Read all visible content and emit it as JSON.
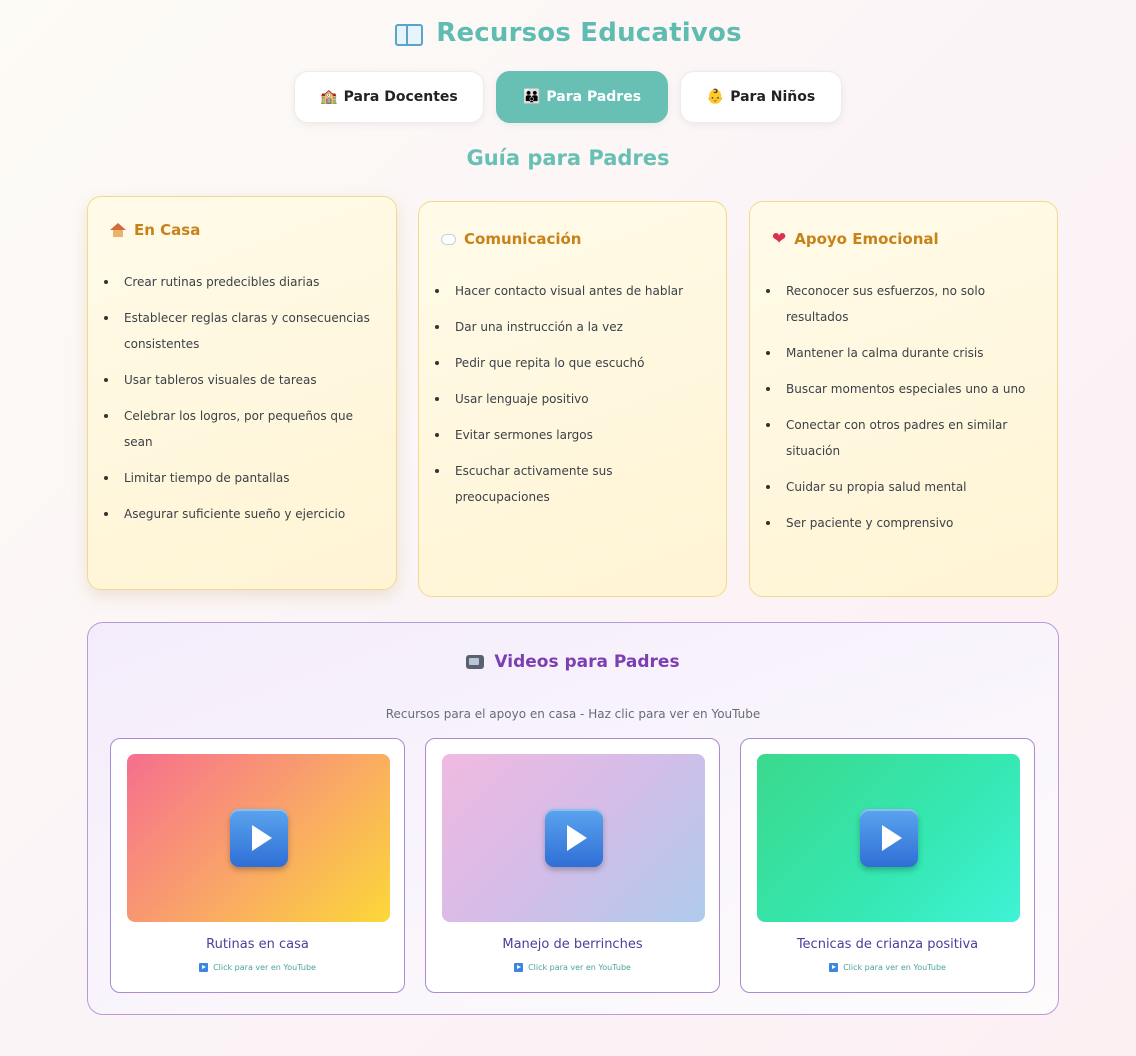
{
  "header": {
    "title": "Recursos Educativos",
    "title_icon": "open-book-icon"
  },
  "tabs": [
    {
      "icon": "🏫",
      "label": "Para Docentes",
      "active": false
    },
    {
      "icon": "👪",
      "label": "Para Padres",
      "active": true
    },
    {
      "icon": "👶",
      "label": "Para Niños",
      "active": false
    }
  ],
  "subtitle": "Guía para Padres",
  "colors": {
    "accent_teal": "#67c0b3",
    "card_title": "#c8821a",
    "card_border": "#f3d98d",
    "video_title": "#7b3fb1",
    "video_border": "#a98ad3"
  },
  "cards": [
    {
      "icon": "house-icon",
      "title": "En Casa",
      "items": [
        "Crear rutinas predecibles diarias",
        "Establecer reglas claras y consecuencias consistentes",
        "Usar tableros visuales de tareas",
        "Celebrar los logros, por pequeños que sean",
        "Limitar tiempo de pantallas",
        "Asegurar suficiente sueño y ejercicio"
      ]
    },
    {
      "icon": "speech-bubble-icon",
      "title": "Comunicación",
      "items": [
        "Hacer contacto visual antes de hablar",
        "Dar una instrucción a la vez",
        "Pedir que repita lo que escuchó",
        "Usar lenguaje positivo",
        "Evitar sermones largos",
        "Escuchar activamente sus preocupaciones"
      ]
    },
    {
      "icon": "heart-icon",
      "title": "Apoyo Emocional",
      "items": [
        "Reconocer sus esfuerzos, no solo resultados",
        "Mantener la calma durante crisis",
        "Buscar momentos especiales uno a uno",
        "Conectar con otros padres en similar situación",
        "Cuidar su propia salud mental",
        "Ser paciente y comprensivo"
      ]
    }
  ],
  "videos": {
    "icon": "tv-icon",
    "title": "Videos para Padres",
    "description": "Recursos para el apoyo en casa - Haz clic para ver en YouTube",
    "link_label": "Click para ver en YouTube",
    "items": [
      {
        "title": "Rutinas en casa"
      },
      {
        "title": "Manejo de berrinches"
      },
      {
        "title": "Tecnicas de crianza positiva"
      }
    ]
  }
}
